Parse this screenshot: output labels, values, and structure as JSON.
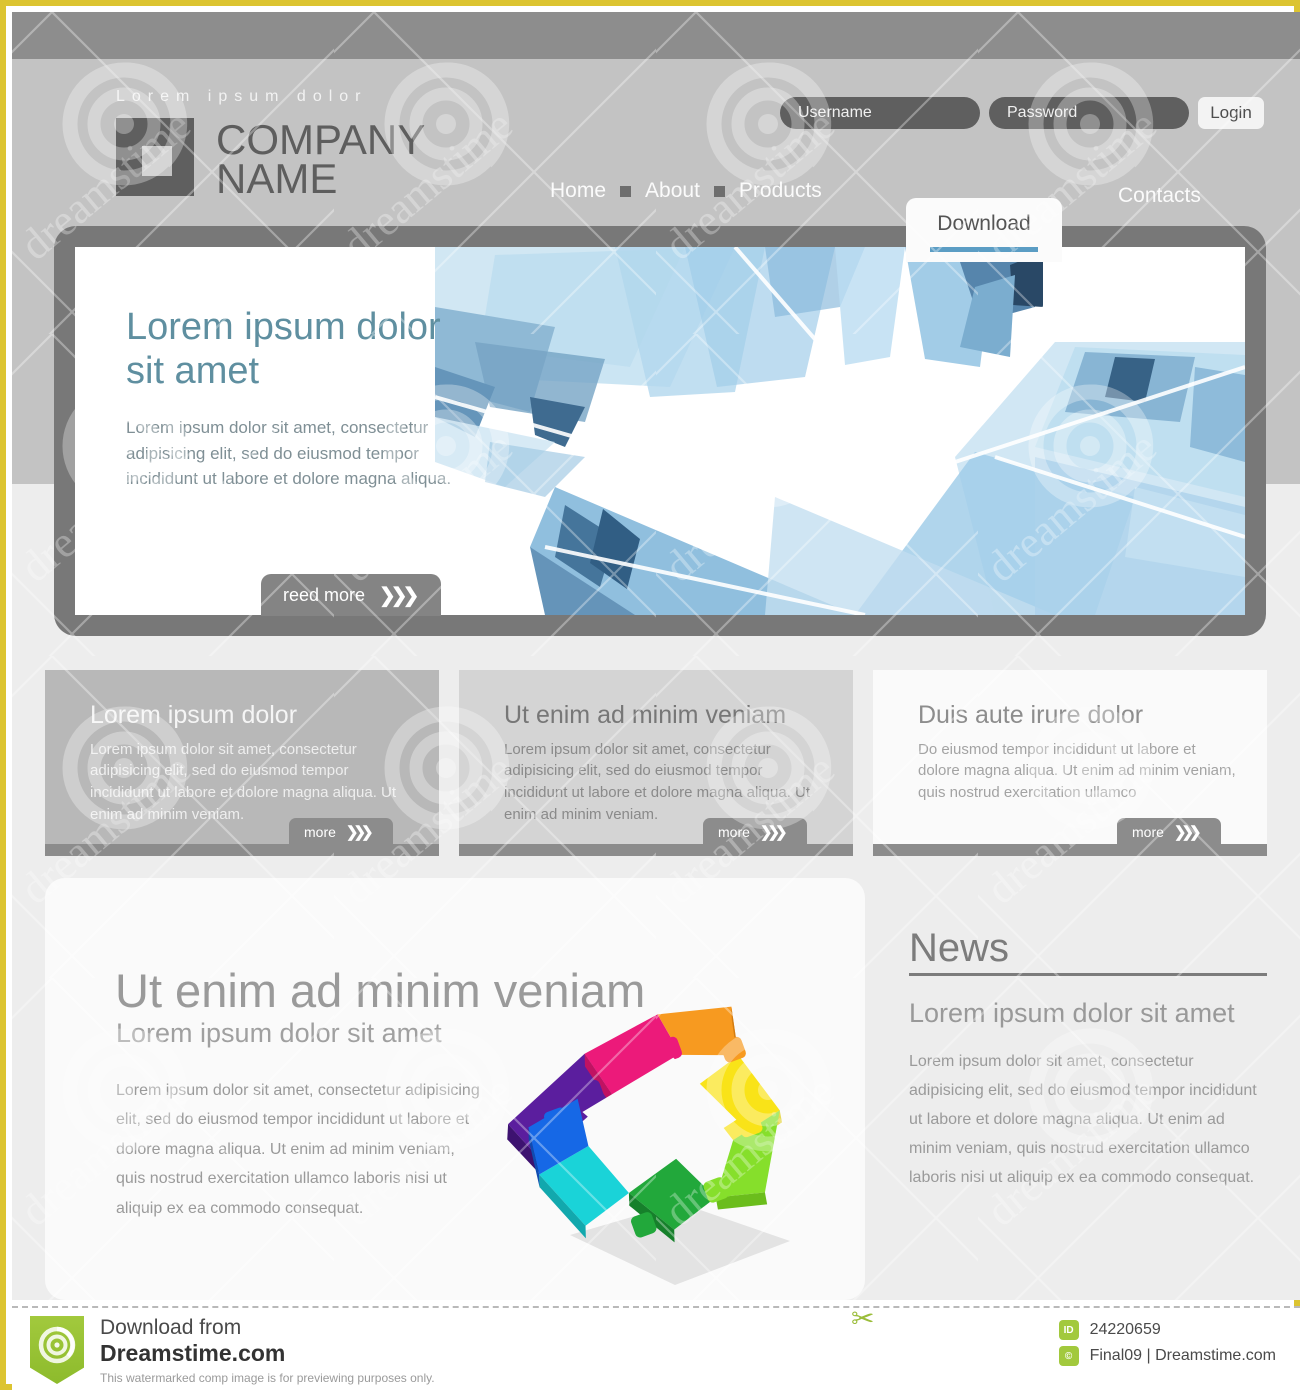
{
  "header": {
    "tagline": "Lorem ipsum dolor",
    "logo": {
      "line1": "COMPANY",
      "line2": "NAME",
      "icon": "square-logo-icon"
    },
    "login": {
      "username_placeholder": "Username",
      "username_value": "",
      "password_placeholder": "Password",
      "password_value": "",
      "login_label": "Login"
    },
    "nav": {
      "items": [
        {
          "label": "Home"
        },
        {
          "label": "About"
        },
        {
          "label": "Products"
        }
      ],
      "contacts": "Contacts",
      "tab": {
        "label": "Download",
        "accent": "#5b9dc4"
      }
    }
  },
  "hero": {
    "heading": "Lorem ipsum dolor sit amet",
    "paragraph": "Lorem ipsum dolor sit amet, consectetur adipisicing elit, sed do eiusmod tempor incididunt ut labore et dolore magna aliqua.",
    "cta": "reed more",
    "cta_icon": "chevrons-right-icon",
    "heading_color": "#5f8fa0",
    "art": "abstract-blue-polygon-crystal-image"
  },
  "feature_boxes": [
    {
      "title": "Lorem ipsum dolor",
      "body": "Lorem ipsum dolor sit amet, consectetur adipisicing elit, sed do eiusmod tempor incididunt ut labore et dolore magna aliqua. Ut enim ad minim veniam.",
      "more_label": "more"
    },
    {
      "title": "Ut enim ad minim veniam",
      "body": "Lorem ipsum dolor sit amet, consectetur adipisicing elit, sed do eiusmod tempor incididunt ut labore et dolore magna aliqua. Ut enim ad minim veniam.",
      "more_label": "more"
    },
    {
      "title": "Duis aute irure dolor",
      "body": "Do eiusmod tempor incididunt ut labore et dolore magna aliqua. Ut enim ad minim veniam, quis nostrud exercitation ullamco",
      "more_label": "more"
    }
  ],
  "bottom": {
    "heading": "Ut enim ad minim veniam",
    "subheading": "Lorem ipsum dolor sit amet",
    "paragraph": "Lorem ipsum dolor sit amet, consectetur adipisicing elit, sed do eiusmod tempor incididunt ut labore et dolore magna aliqua. Ut enim ad minim veniam, quis nostrud exercitation ullamco laboris nisi ut aliquip ex ea commodo consequat.",
    "image": "colorful-3d-puzzle-square-image"
  },
  "news": {
    "title": "News",
    "subtitle": "Lorem ipsum dolor sit amet",
    "paragraph": "Lorem ipsum dolor sit amet, consectetur adipisicing elit, sed do eiusmod tempor incididunt ut labore et dolore magna aliqua. Ut enim ad minim veniam, quis nostrud exercitation ullamco laboris nisi ut aliquip ex ea commodo consequat."
  },
  "watermark": {
    "text": "dreamstime"
  },
  "stock_footer": {
    "line1": "Download from",
    "line2": "Dreamstime.com",
    "disclaimer": "This watermarked comp image is for previewing purposes only.",
    "id_chip": "ID",
    "id_value": "24220659",
    "copyright_chip": "©",
    "copyright_value": "Final09 | Dreamstime.com"
  }
}
